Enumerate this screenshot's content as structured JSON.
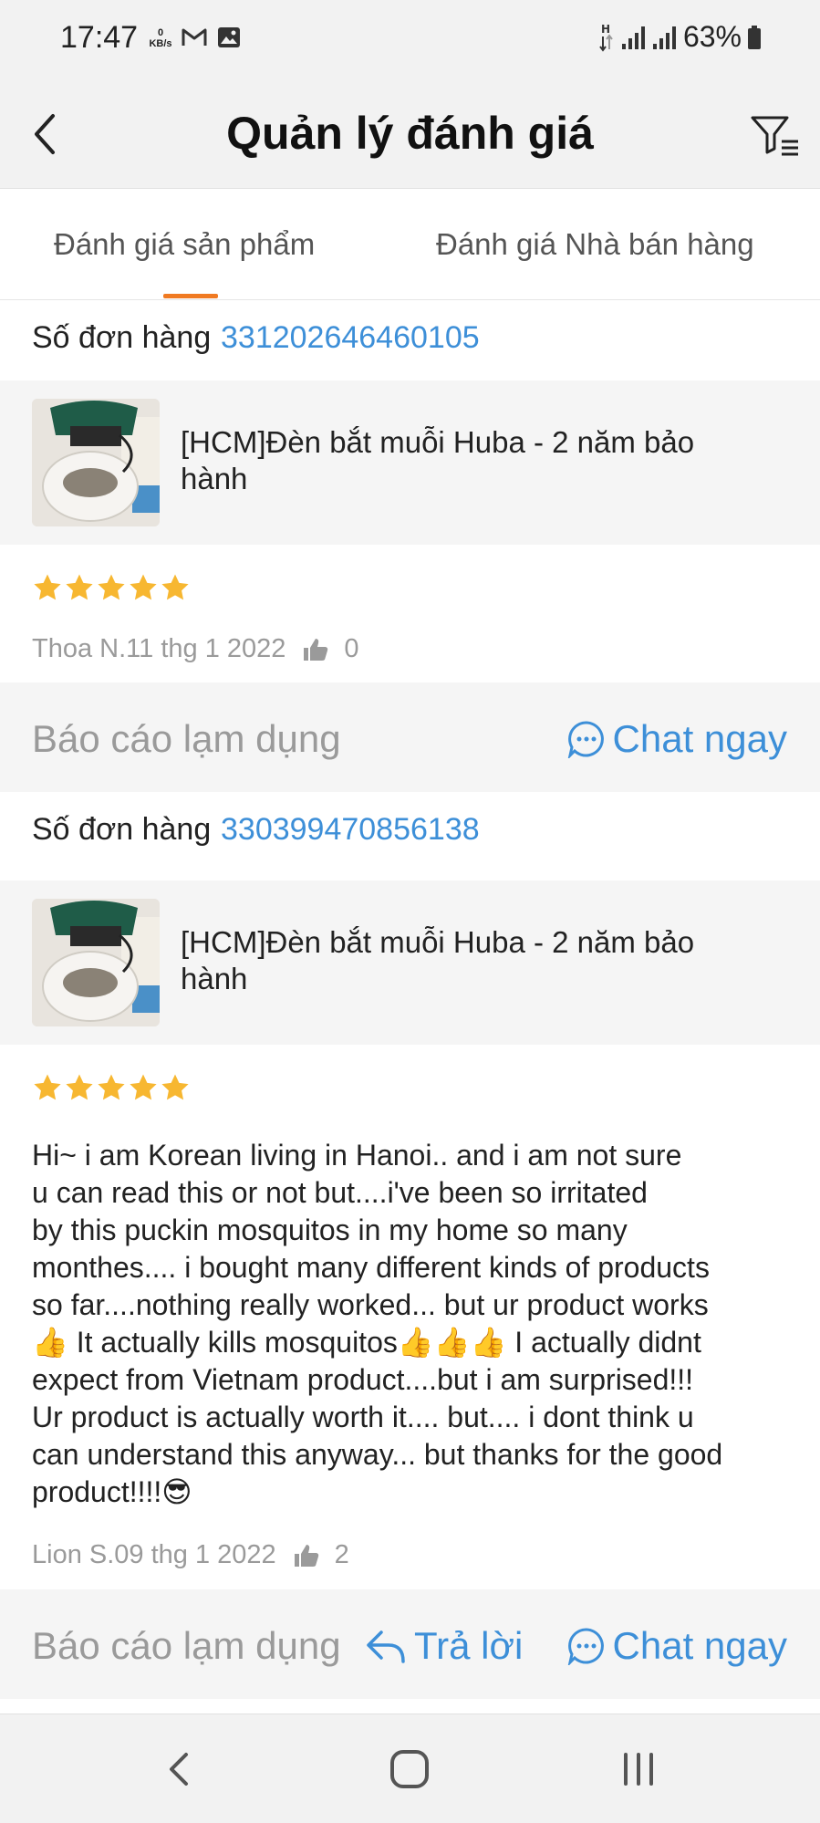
{
  "status_bar": {
    "time": "17:47",
    "net_speed": "0",
    "net_unit": "KB/s",
    "network_type": "H",
    "battery": "63%"
  },
  "header": {
    "title": "Quản lý đánh giá"
  },
  "tabs": [
    {
      "label": "Đánh giá sản phẩm",
      "active": true
    },
    {
      "label": "Đánh giá Nhà bán hàng",
      "active": false
    }
  ],
  "colors": {
    "accent": "#f07a22",
    "link": "#3d8fd8",
    "star": "#f7b731"
  },
  "reviews": [
    {
      "order_label": "Số đơn hàng",
      "order_number": "331202646460105",
      "product_name": "[HCM]Đèn bắt muỗi Huba - 2 năm bảo hành",
      "rating": 5,
      "text": "",
      "author_date": "Thoa N.11 thg 1 2022",
      "likes": "0",
      "report_label": "Báo cáo lạm dụng",
      "chat_label": "Chat ngay"
    },
    {
      "order_label": "Số đơn hàng",
      "order_number": "330399470856138",
      "product_name": "[HCM]Đèn bắt muỗi Huba - 2 năm bảo hành",
      "rating": 5,
      "text_lines": [
        "Hi~ i am Korean living in Hanoi.. and i am not sure",
        "u can read this or not but....i've been so irritated",
        "by this puckin mosquitos in my home so many",
        "monthes.... i bought many different kinds of products",
        "so far....nothing really worked... but ur product works",
        "👍 It actually kills mosquitos👍👍👍 I actually didnt",
        "expect from Vietnam product....but i am surprised!!!",
        "Ur product is actually worth it.... but.... i dont think u",
        "can understand this anyway... but thanks for the good",
        "product!!!!😎"
      ],
      "author_date": "Lion S.09 thg 1 2022",
      "likes": "2",
      "report_label": "Báo cáo lạm dụng",
      "reply_label": "Trả lời",
      "chat_label": "Chat ngay"
    }
  ]
}
